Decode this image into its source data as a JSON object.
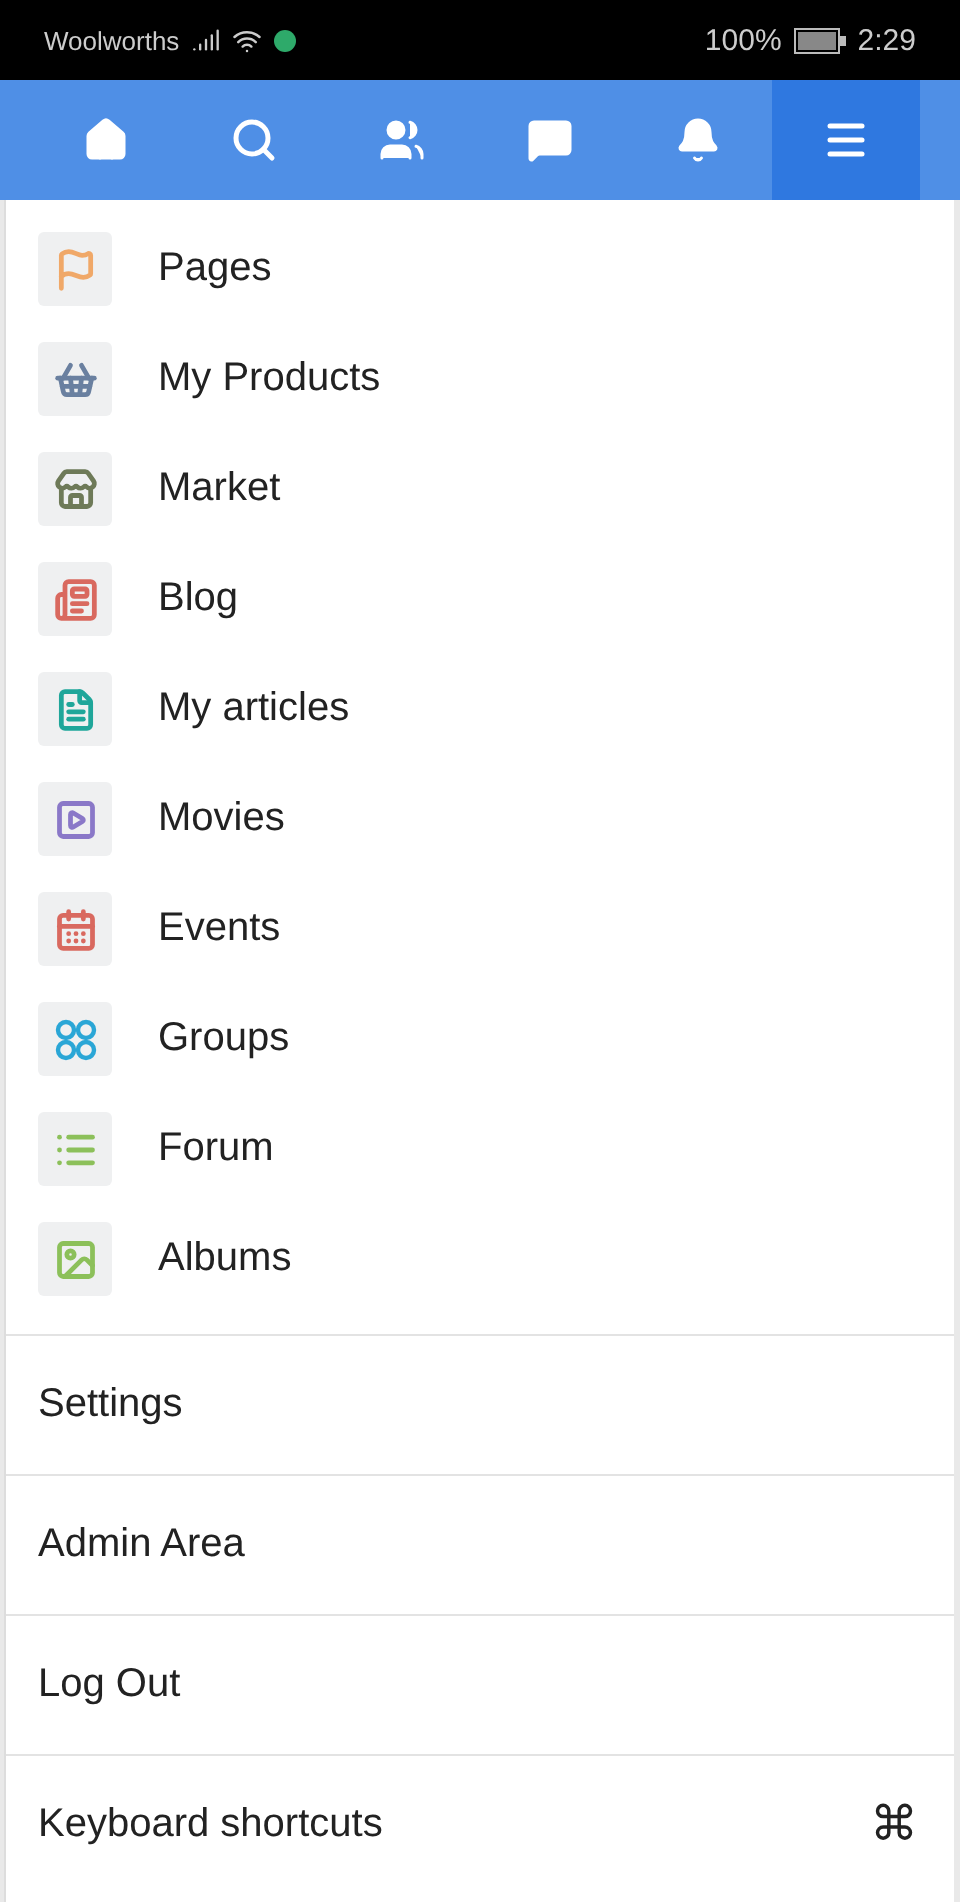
{
  "status_bar": {
    "carrier": "Woolworths",
    "battery": "100%",
    "time": "2:29"
  },
  "nav_tabs": [
    {
      "selected": false
    },
    {
      "selected": false
    },
    {
      "selected": false
    },
    {
      "selected": false
    },
    {
      "selected": false
    },
    {
      "selected": true
    }
  ],
  "menu_items": [
    {
      "label": "Pages",
      "color": "#f0a868"
    },
    {
      "label": "My Products",
      "color": "#6a80a0"
    },
    {
      "label": "Market",
      "color": "#6e7a58"
    },
    {
      "label": "Blog",
      "color": "#d9695f"
    },
    {
      "label": "My articles",
      "color": "#1fa69a"
    },
    {
      "label": "Movies",
      "color": "#8a78c8"
    },
    {
      "label": "Events",
      "color": "#d9695f"
    },
    {
      "label": "Groups",
      "color": "#2aa6d6"
    },
    {
      "label": "Forum",
      "color": "#8cc05a"
    },
    {
      "label": "Albums",
      "color": "#8cc05a"
    }
  ],
  "links": [
    {
      "label": "Settings"
    },
    {
      "label": "Admin Area"
    },
    {
      "label": "Log Out"
    },
    {
      "label": "Keyboard shortcuts",
      "shortcut": "⌘"
    }
  ]
}
